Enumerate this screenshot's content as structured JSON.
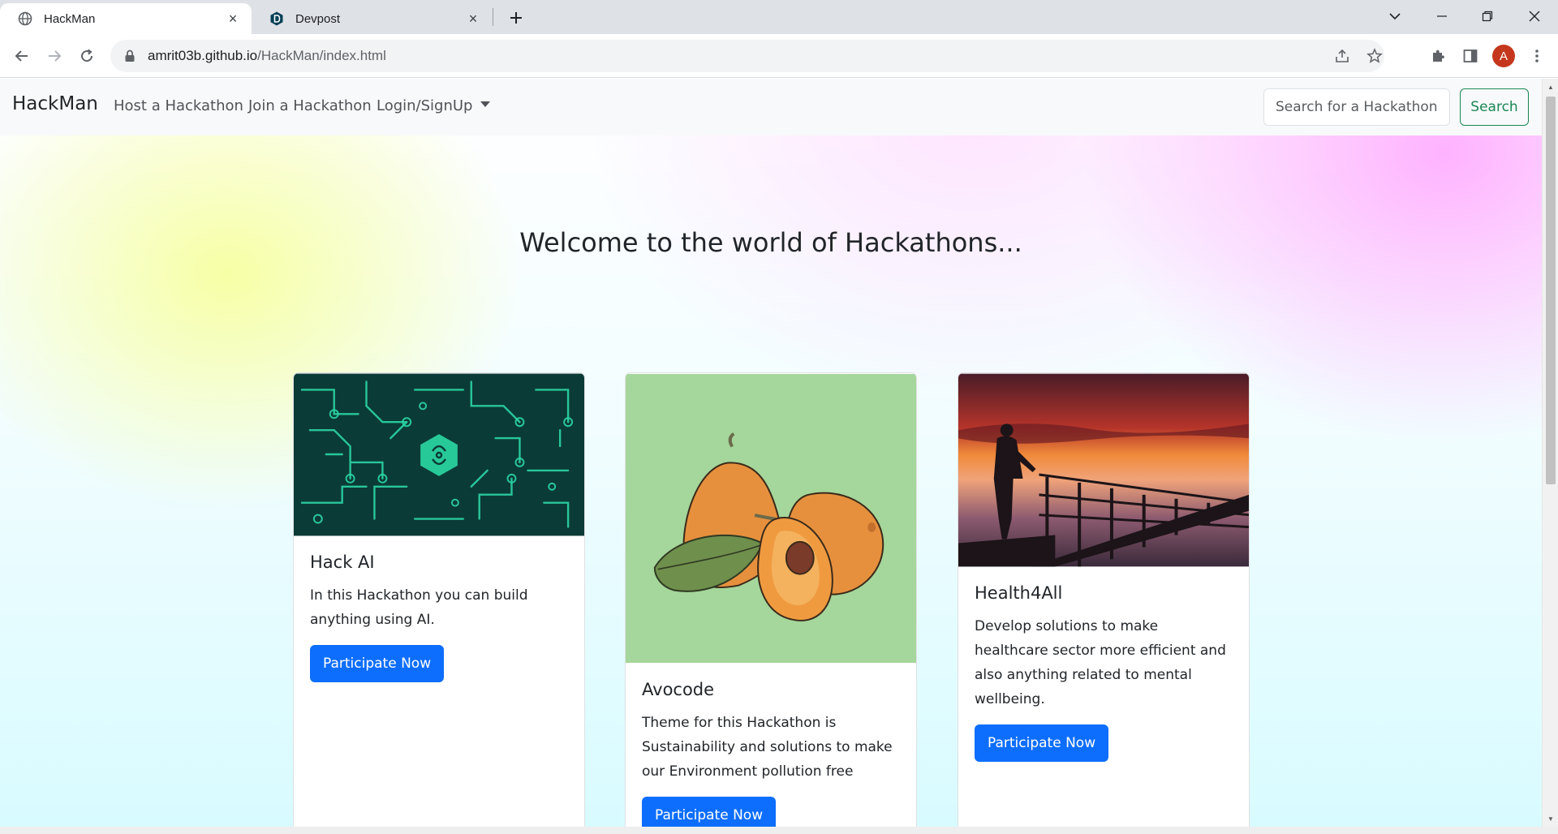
{
  "browser": {
    "tabs": [
      {
        "title": "HackMan",
        "active": true
      },
      {
        "title": "Devpost",
        "active": false
      }
    ],
    "url": {
      "host": "amrit03b.github.io",
      "path": "/HackMan/index.html"
    },
    "profile_initial": "A"
  },
  "site": {
    "brand": "HackMan",
    "nav": {
      "host": "Host a Hackathon",
      "join": "Join a Hackathon",
      "login": "Login/SignUp"
    },
    "search": {
      "placeholder": "Search for a Hackathon",
      "button": "Search"
    },
    "hero_title": "Welcome to the world of Hackathons...",
    "cards": [
      {
        "title": "Hack AI",
        "text": "In this Hackathon you can build anything using AI.",
        "button": "Participate Now"
      },
      {
        "title": "Avocode",
        "text": "Theme for this Hackathon is Sustainability and solutions to make our Environment pollution free",
        "button": "Participate Now"
      },
      {
        "title": "Health4All",
        "text": "Develop solutions to make healthcare sector more efficient and also anything related to mental wellbeing.",
        "button": "Participate Now"
      }
    ]
  },
  "colors": {
    "primary": "#0d6efd",
    "success": "#198754",
    "navbar_bg": "#f8f9fa",
    "circuit_bg": "#0b3b36",
    "circuit_line": "#2cd6a5",
    "fruit_bg": "#a5d69b"
  }
}
